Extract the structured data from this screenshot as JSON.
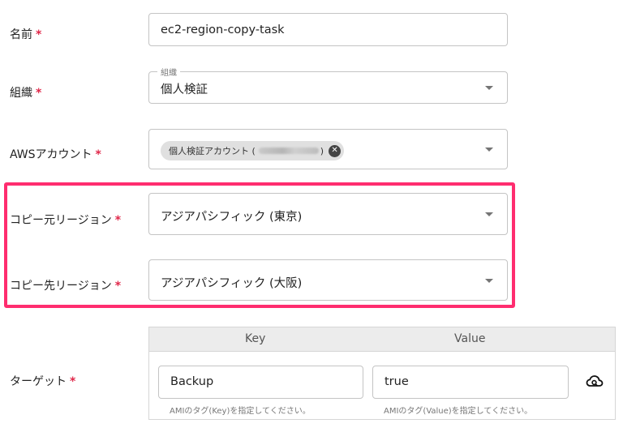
{
  "name": {
    "label": "名前",
    "required": "*",
    "value": "ec2-region-copy-task"
  },
  "organization": {
    "label": "組織",
    "required": "*",
    "legend": "組織",
    "value": "個人検証"
  },
  "aws_account": {
    "label": "AWSアカウント",
    "required": "*",
    "chip_prefix": "個人検証アカウント (",
    "chip_suffix": ")"
  },
  "source_region": {
    "label": "コピー元リージョン",
    "required": "*",
    "value": "アジアパシフィック (東京)"
  },
  "dest_region": {
    "label": "コピー先リージョン",
    "required": "*",
    "value": "アジアパシフィック (大阪)"
  },
  "target": {
    "label": "ターゲット",
    "required": "*",
    "col_key": "Key",
    "col_value": "Value",
    "key_value": "Backup",
    "value_value": "true",
    "key_helper": "AMIのタグ(Key)を指定してください。",
    "value_helper": "AMIのタグ(Value)を指定してください。"
  },
  "colors": {
    "highlight": "#ff2d6f",
    "required": "#e0284a"
  },
  "icons": {
    "chip_delete": "close-circle-icon",
    "dropdown": "chevron-down-icon",
    "tag_action": "cloud-search-icon"
  }
}
